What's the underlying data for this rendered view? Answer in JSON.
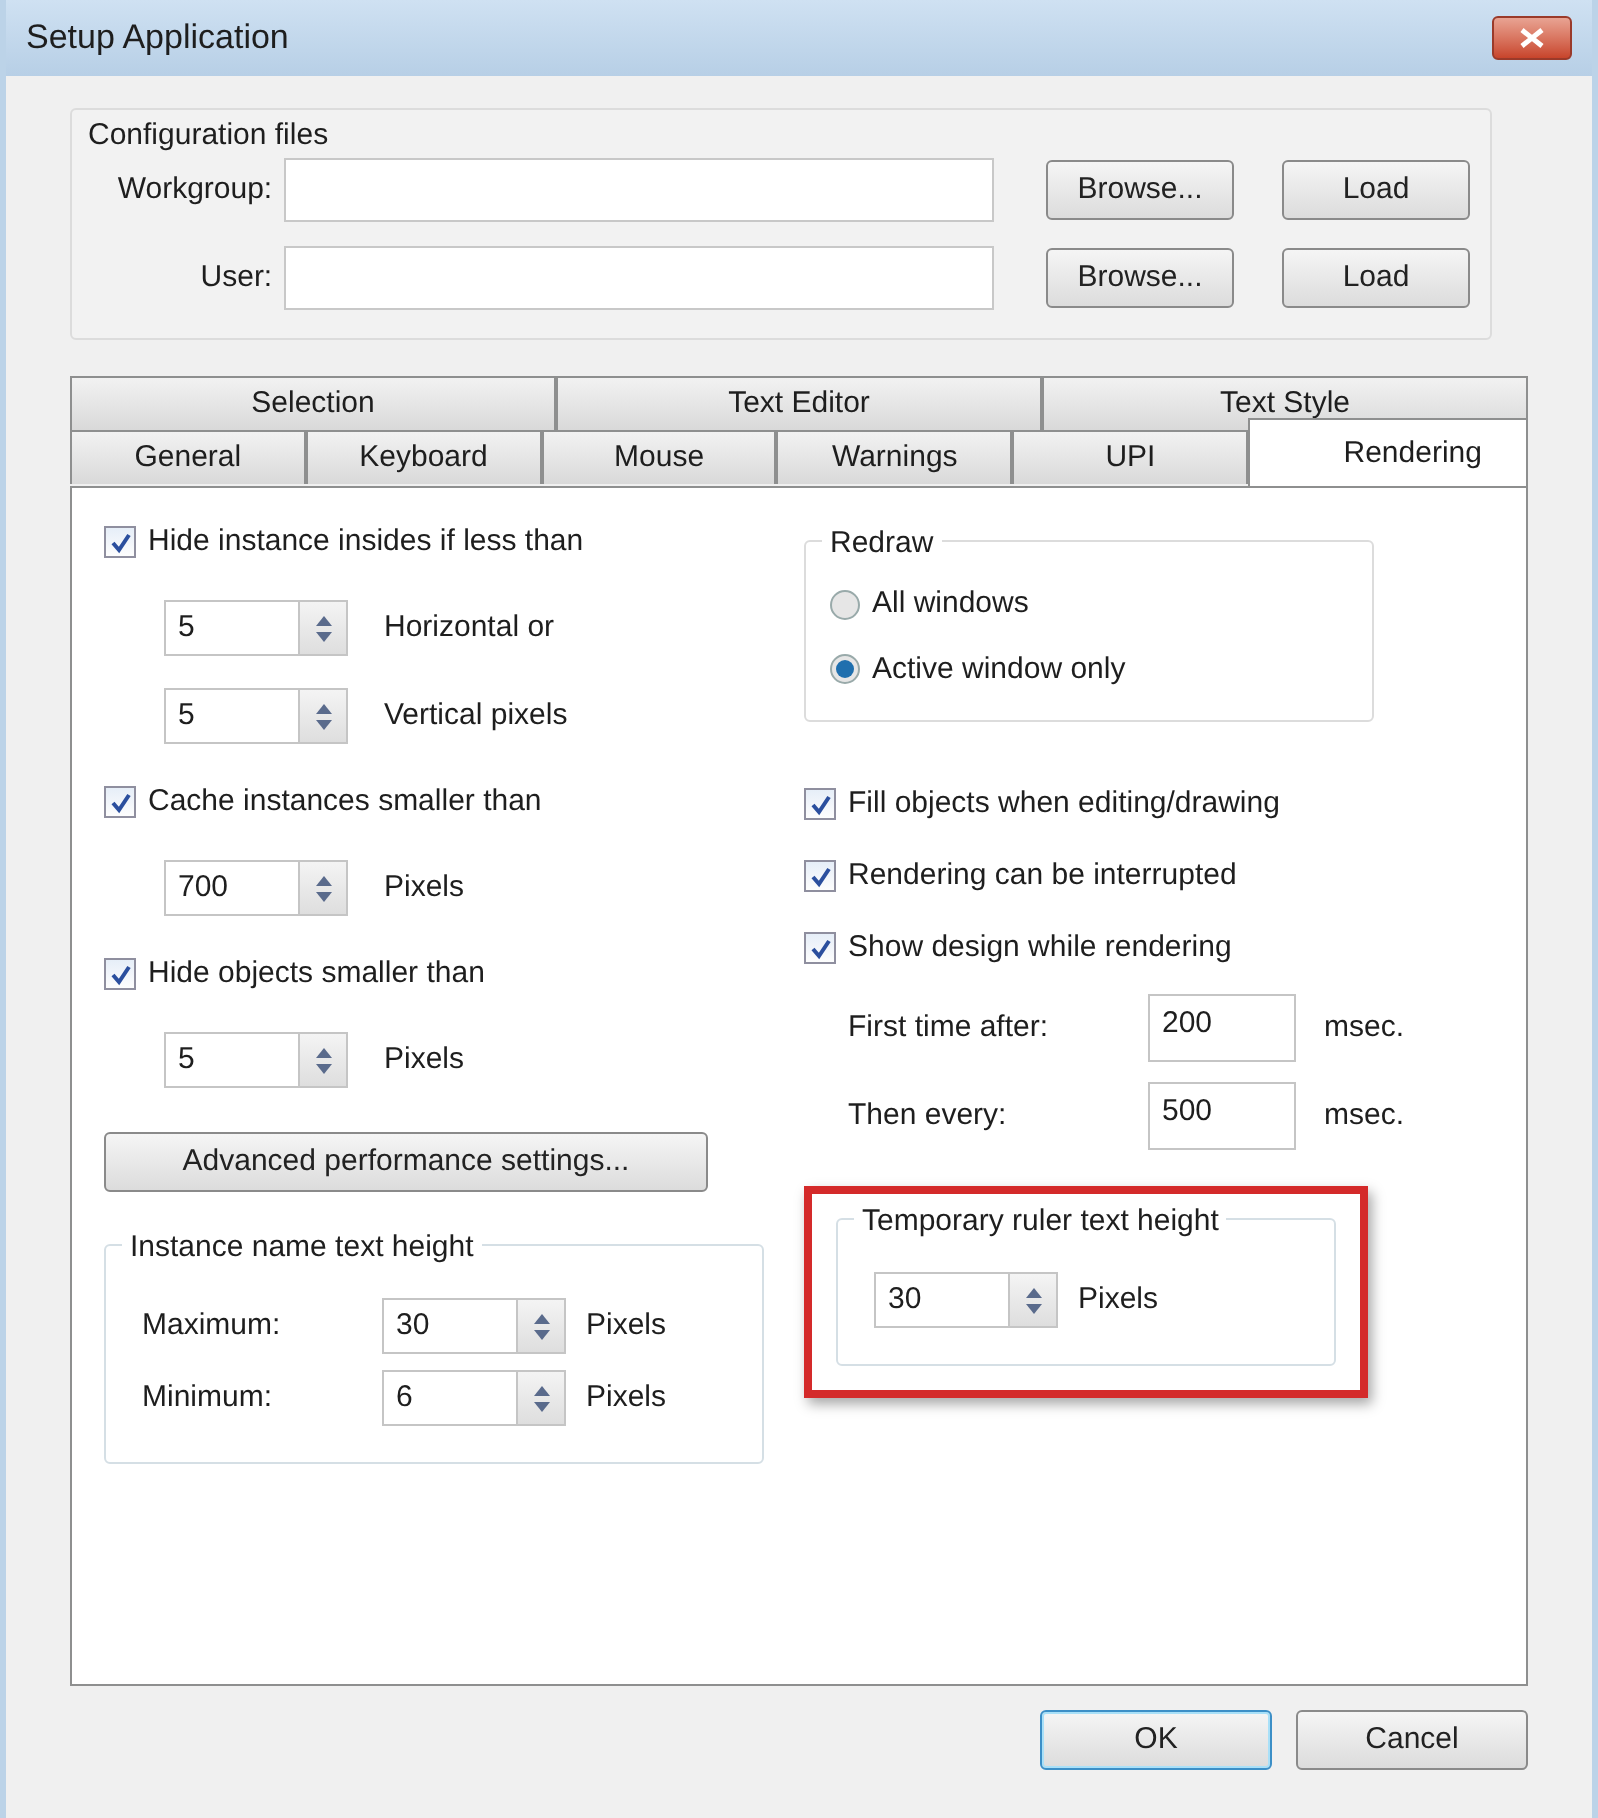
{
  "window": {
    "title": "Setup Application"
  },
  "config_files": {
    "title": "Configuration files",
    "rows": [
      {
        "label": "Workgroup:",
        "browse": "Browse...",
        "load": "Load"
      },
      {
        "label": "User:",
        "browse": "Browse...",
        "load": "Load"
      }
    ]
  },
  "tab_rows": [
    [
      {
        "label": "Selection",
        "selected": false
      },
      {
        "label": "Text Editor",
        "selected": false
      },
      {
        "label": "Text Style",
        "selected": false
      }
    ],
    [
      {
        "label": "General",
        "selected": false
      },
      {
        "label": "Keyboard",
        "selected": false
      },
      {
        "label": "Mouse",
        "selected": false
      },
      {
        "label": "Warnings",
        "selected": false
      },
      {
        "label": "UPI",
        "selected": false
      },
      {
        "label": "Rendering",
        "selected": true
      }
    ]
  ],
  "left_options": [
    {
      "kind": "checkbox",
      "label": "Hide instance insides if less than",
      "checked": true
    },
    {
      "kind": "spinner",
      "value": "5",
      "unit": "Horizontal or"
    },
    {
      "kind": "spinner",
      "value": "5",
      "unit": "Vertical pixels"
    },
    {
      "kind": "checkbox",
      "label": "Cache instances smaller than",
      "checked": true
    },
    {
      "kind": "spinner",
      "value": "700",
      "unit": "Pixels"
    },
    {
      "kind": "checkbox",
      "label": "Hide objects smaller than",
      "checked": true
    },
    {
      "kind": "spinner",
      "value": "5",
      "unit": "Pixels"
    }
  ],
  "advanced_button": "Advanced performance settings...",
  "instance_name_text_height": {
    "title": "Instance name text height",
    "highlighted": false,
    "rows": [
      {
        "label": "Maximum:",
        "value": "30",
        "unit": "Pixels"
      },
      {
        "label": "Minimum:",
        "value": "6",
        "unit": "Pixels"
      }
    ]
  },
  "redraw": {
    "title": "Redraw",
    "options": [
      {
        "label": "All windows",
        "selected": false
      },
      {
        "label": "Active window only",
        "selected": true
      }
    ]
  },
  "right_options": [
    {
      "kind": "checkbox",
      "label": "Fill objects when editing/drawing",
      "checked": true
    },
    {
      "kind": "checkbox",
      "label": "Rendering can be interrupted",
      "checked": true
    },
    {
      "kind": "checkbox",
      "label": "Show design while rendering",
      "checked": true
    },
    {
      "kind": "field",
      "label": "First time after:",
      "value": "200",
      "unit": "msec."
    },
    {
      "kind": "field",
      "label": "Then every:",
      "value": "500",
      "unit": "msec."
    }
  ],
  "temporary_ruler_text_height": {
    "title": "Temporary ruler text height",
    "highlighted": true,
    "rows": [
      {
        "value": "30",
        "unit": "Pixels"
      }
    ]
  },
  "buttons": [
    {
      "label": "OK",
      "default": true
    },
    {
      "label": "Cancel",
      "default": false
    }
  ]
}
